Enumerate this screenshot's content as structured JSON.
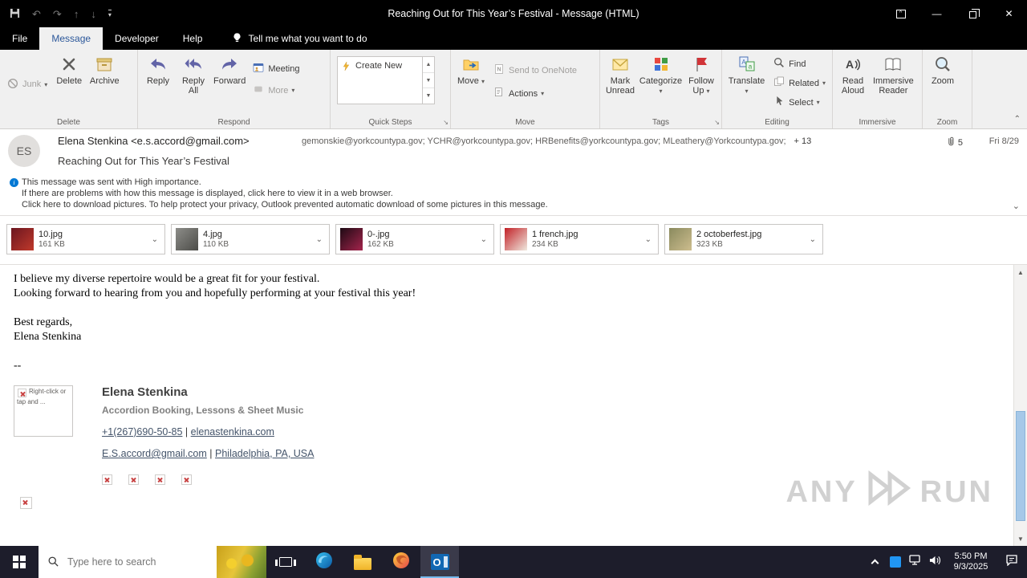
{
  "window": {
    "title": "Reaching Out for This Year’s Festival  -  Message (HTML)"
  },
  "tabs": {
    "items": [
      {
        "label": "File"
      },
      {
        "label": "Message"
      },
      {
        "label": "Developer"
      },
      {
        "label": "Help"
      }
    ],
    "tellme": "Tell me what you want to do"
  },
  "ribbon": {
    "junk": "Junk",
    "delete": "Delete",
    "archive": "Archive",
    "reply": "Reply",
    "reply_all": "Reply\nAll",
    "forward": "Forward",
    "meeting": "Meeting",
    "more": "More",
    "create_new": "Create New",
    "move": "Move",
    "send_to_onenote": "Send to OneNote",
    "actions": "Actions",
    "mark_unread": "Mark\nUnread",
    "categorize": "Categorize",
    "follow_up": "Follow\nUp",
    "translate": "Translate",
    "find": "Find",
    "related": "Related",
    "select": "Select",
    "read_aloud": "Read\nAloud",
    "immersive_reader": "Immersive\nReader",
    "zoom": "Zoom",
    "group_labels": [
      "Delete",
      "Respond",
      "Quick Steps",
      "Move",
      "Tags",
      "Editing",
      "Immersive",
      "Zoom"
    ]
  },
  "header": {
    "avatar_initials": "ES",
    "from": "Elena Stenkina <e.s.accord@gmail.com>",
    "recipients": "gemonskie@yorkcountypa.gov; YCHR@yorkcountypa.gov; HRBenefits@yorkcountypa.gov; MLeathery@Yorkcountypa.gov;",
    "more_recipients": "+ 13",
    "attachment_count": "5",
    "date": "Fri 8/29",
    "subject": "Reaching Out for This Year’s Festival"
  },
  "infobar": {
    "line1": "This message was sent with High importance.",
    "line2": "If there are problems with how this message is displayed, click here to view it in a web browser.",
    "line3": "Click here to download pictures. To help protect your privacy, Outlook prevented automatic download of some pictures in this message."
  },
  "attachments": [
    {
      "name": "10.jpg",
      "size": "161 KB",
      "thumb": [
        "#6b1620",
        "#c0392b"
      ]
    },
    {
      "name": "4.jpg",
      "size": "110 KB",
      "thumb": [
        "#8d8d89",
        "#4c4c48"
      ]
    },
    {
      "name": "0-.jpg",
      "size": "162 KB",
      "thumb": [
        "#1d0a14",
        "#a4244c"
      ]
    },
    {
      "name": "1 french.jpg",
      "size": "234 KB",
      "thumb": [
        "#c22127",
        "#efe9df"
      ]
    },
    {
      "name": "2 octoberfest.jpg",
      "size": "323 KB",
      "thumb": [
        "#8a8a5e",
        "#cdbd8e"
      ]
    }
  ],
  "body": {
    "line1": "I believe my diverse repertoire would be a great fit for your festival.",
    "line2": "Looking forward to hearing from you and hopefully performing at your festival this year!",
    "closing": "Best regards,",
    "sender": "Elena Stenkina",
    "separator": "--"
  },
  "signature": {
    "broken_image_text": "Right-click or tap and ...",
    "name": "Elena Stenkina",
    "tagline": "Accordion Booking, Lessons & Sheet Music",
    "phone": "+1(267)690-50-85",
    "pipe": "|",
    "website": "elenastenkina.com",
    "email": "E.S.accord@gmail.com",
    "location": "Philadelphia, PA, USA"
  },
  "watermark": {
    "left": "ANY",
    "right": "RUN"
  },
  "taskbar": {
    "search_placeholder": "Type here to search",
    "time": "5:50 PM",
    "date": "9/3/2025"
  },
  "colors": {
    "accent_blue": "#2b579a",
    "info_icon_blue": "#0078d4",
    "flag_red": "#d13438",
    "respond_purple": "#6264a7"
  }
}
